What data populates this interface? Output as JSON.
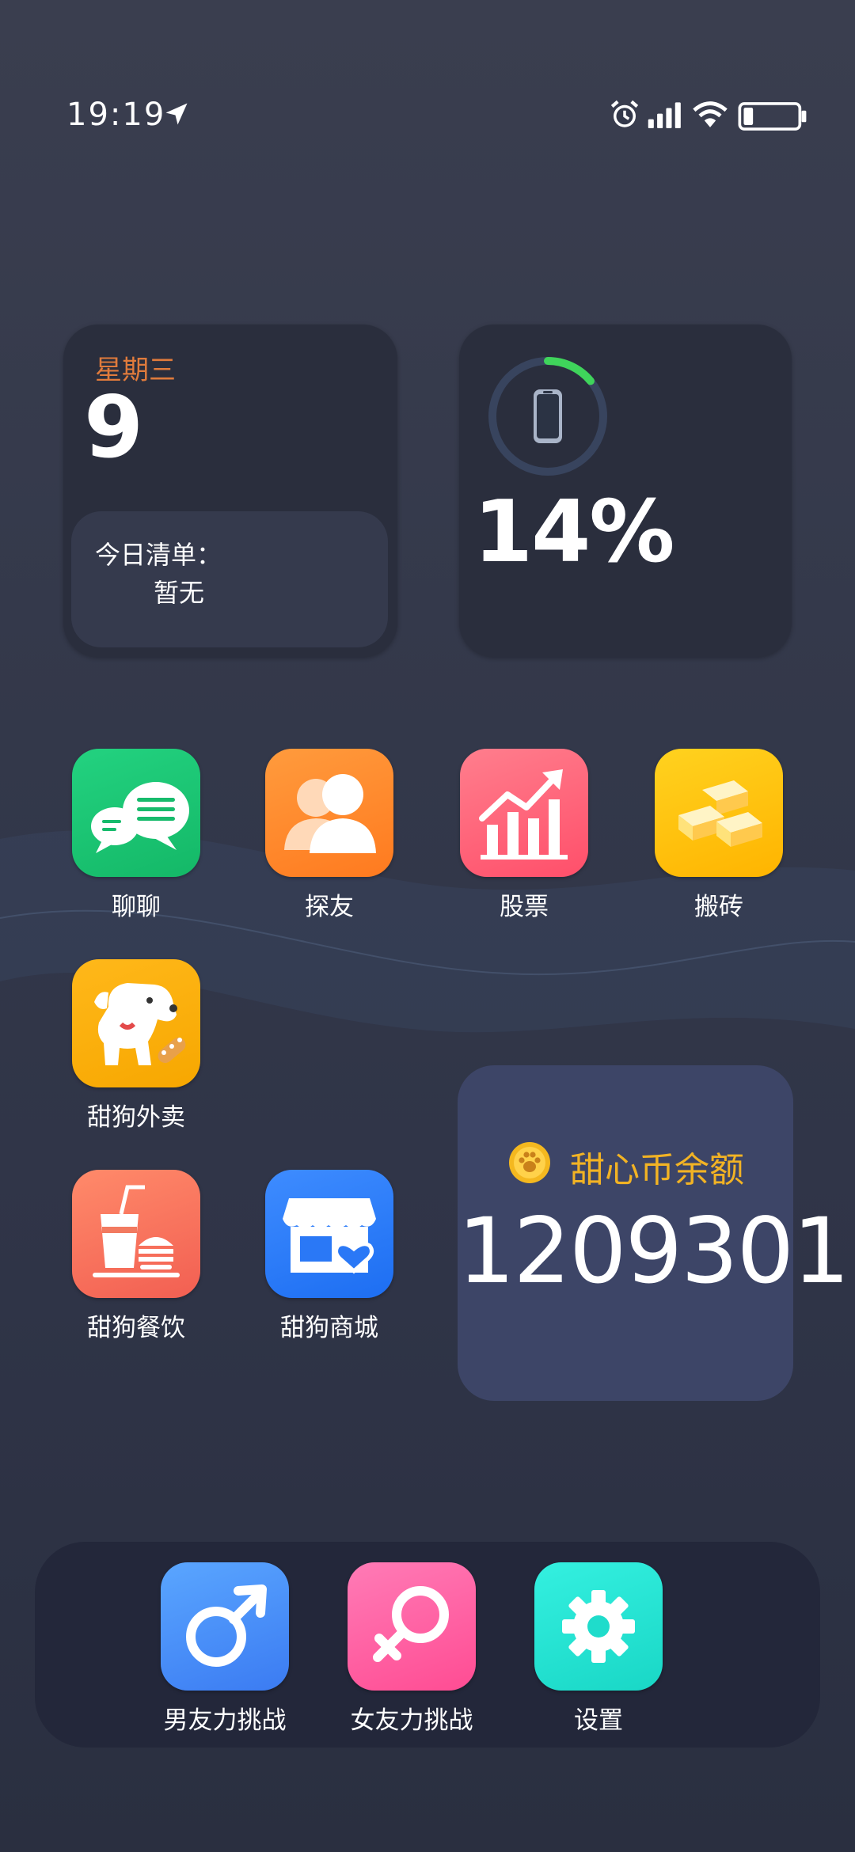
{
  "status_bar": {
    "time": "19:19"
  },
  "date_widget": {
    "weekday": "星期三",
    "day": "9",
    "todo_title": "今日清单：",
    "todo_value": "暂无"
  },
  "battery_widget": {
    "percent": "14%",
    "level": 0.14
  },
  "apps": [
    {
      "id": "chat",
      "label": "聊聊"
    },
    {
      "id": "friends",
      "label": "探友"
    },
    {
      "id": "stocks",
      "label": "股票"
    },
    {
      "id": "work",
      "label": "搬砖"
    },
    {
      "id": "delivery",
      "label": "甜狗外卖"
    },
    {
      "id": "dining",
      "label": "甜狗餐饮"
    },
    {
      "id": "mall",
      "label": "甜狗商城"
    }
  ],
  "balance_widget": {
    "label": "甜心币余额",
    "value": "1209301"
  },
  "dock": [
    {
      "id": "boyfriend",
      "label": "男友力挑战"
    },
    {
      "id": "girlfriend",
      "label": "女友力挑战"
    },
    {
      "id": "settings",
      "label": "设置"
    }
  ],
  "colors": {
    "weekday": "#e07b3c",
    "balance_label": "#f2b324",
    "battery_ring": "#3fd45b"
  },
  "icons": {
    "chat": "speech-bubbles-icon",
    "friends": "people-icon",
    "stocks": "rising-chart-icon",
    "work": "gold-bars-icon",
    "delivery": "dog-icon",
    "dining": "drink-burger-icon",
    "mall": "shop-heart-icon",
    "boyfriend": "male-symbol-icon",
    "girlfriend": "female-symbol-icon",
    "settings": "gear-icon"
  }
}
